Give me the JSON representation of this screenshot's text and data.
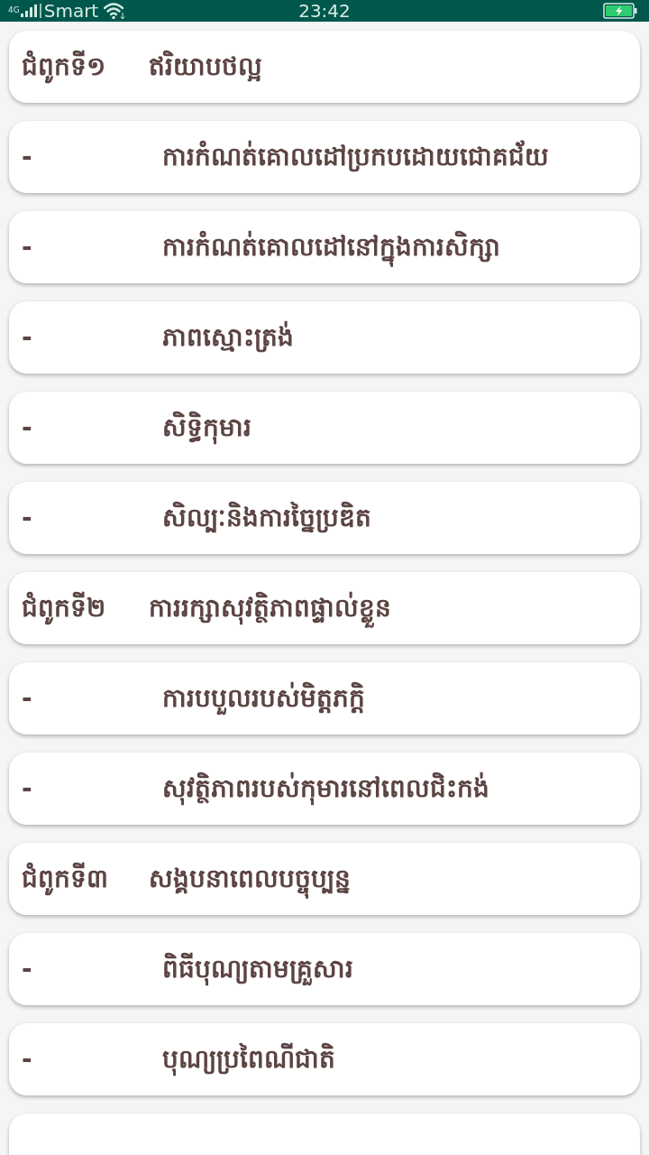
{
  "status_bar": {
    "network": "4G",
    "carrier": "Smart",
    "time": "23:42",
    "charging": true
  },
  "rows": [
    {
      "kind": "chapter",
      "label": "ជំពូកទី១",
      "title": "ឥរិយាបថល្អ"
    },
    {
      "kind": "lesson",
      "label": "-",
      "title": "ការកំណត់គោលដៅប្រកបដោយជោគជ័យ"
    },
    {
      "kind": "lesson",
      "label": "-",
      "title": "ការកំណត់គោលដៅនៅក្នុងការសិក្សា"
    },
    {
      "kind": "lesson",
      "label": "-",
      "title": "ភាពស្មោះត្រង់"
    },
    {
      "kind": "lesson",
      "label": "-",
      "title": "សិទ្ធិកុមារ"
    },
    {
      "kind": "lesson",
      "label": "-",
      "title": "សិល្បៈនិងការច្នៃប្រឌិត"
    },
    {
      "kind": "chapter",
      "label": "ជំពូកទី២",
      "title": "ការរក្សាសុវត្ថិភាពផ្ទាល់ខ្លួន"
    },
    {
      "kind": "lesson",
      "label": "-",
      "title": "ការបបួលរបស់មិត្តភក្តិ"
    },
    {
      "kind": "lesson",
      "label": "-",
      "title": "សុវត្ថិភាពរបស់កុមារនៅពេលជិះកង់"
    },
    {
      "kind": "chapter",
      "label": "ជំពូកទី៣",
      "title": "សង្គបនាពេលបច្ចុប្បន្ន"
    },
    {
      "kind": "lesson",
      "label": "-",
      "title": "ពិធីបុណ្យតាមគ្រួសារ"
    },
    {
      "kind": "lesson",
      "label": "-",
      "title": "បុណ្យប្រពៃណីជាតិ"
    },
    {
      "kind": "clipped"
    }
  ]
}
